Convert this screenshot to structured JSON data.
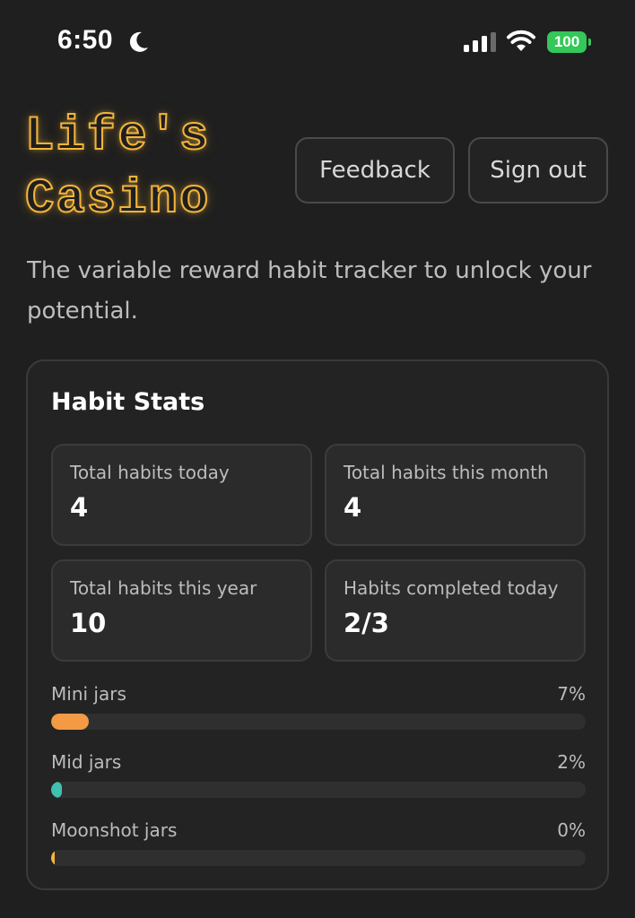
{
  "status_bar": {
    "time": "6:50",
    "battery": "100"
  },
  "header": {
    "logo_line1": "Life's",
    "logo_line2": "Casino",
    "feedback_label": "Feedback",
    "signout_label": "Sign out"
  },
  "tagline": "The variable reward habit tracker to unlock your potential.",
  "stats": {
    "title": "Habit Stats",
    "boxes": [
      {
        "label": "Total habits today",
        "value": "4"
      },
      {
        "label": "Total habits this month",
        "value": "4"
      },
      {
        "label": "Total habits this year",
        "value": "10"
      },
      {
        "label": "Habits completed today",
        "value": "2/3"
      }
    ],
    "jars": [
      {
        "label": "Mini jars",
        "percent_text": "7%",
        "fraction": 0.07,
        "color": "#f39a45"
      },
      {
        "label": "Mid jars",
        "percent_text": "2%",
        "fraction": 0.02,
        "color": "#3fc0b0"
      },
      {
        "label": "Moonshot jars",
        "percent_text": "0%",
        "fraction": 0.0,
        "color": "#f3b53a"
      }
    ]
  },
  "colors": {
    "background": "#1f1f1f",
    "logo_neon": "#f3b53a",
    "battery_green": "#34c759"
  },
  "icons": [
    "moon-icon",
    "cellular-signal-icon",
    "wifi-icon",
    "battery-icon"
  ]
}
